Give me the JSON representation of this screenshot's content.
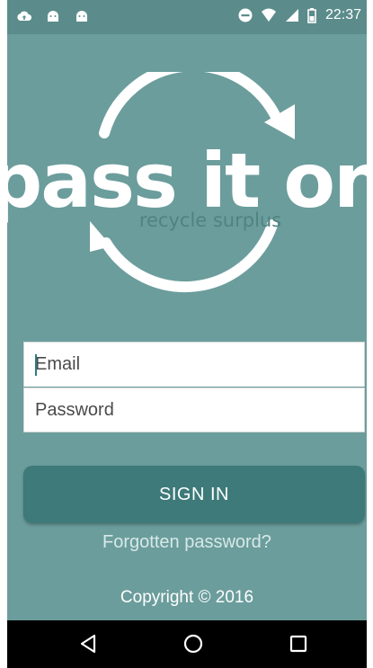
{
  "status_bar": {
    "time": "22:37",
    "left_icons": [
      "cloud-upload-icon",
      "android-icon",
      "android-icon"
    ],
    "right_icons": [
      "do-not-disturb-icon",
      "wifi-icon",
      "signal-icon",
      "battery-icon"
    ]
  },
  "logo": {
    "wordmark": "pass it on",
    "tagline": "recycle surplus"
  },
  "form": {
    "email_placeholder": "Email",
    "password_placeholder": "Password"
  },
  "actions": {
    "sign_in_label": "SIGN IN",
    "forgot_label": "Forgotten password?"
  },
  "footer": {
    "copyright": "Copyright © 2016"
  },
  "nav_bar": {
    "buttons": [
      "back-icon",
      "home-icon",
      "recents-icon"
    ]
  },
  "colors": {
    "background": "#6b9d9c",
    "status_bar": "#5b8c8b",
    "button": "#3d7a79",
    "nav_bar": "#000000"
  }
}
